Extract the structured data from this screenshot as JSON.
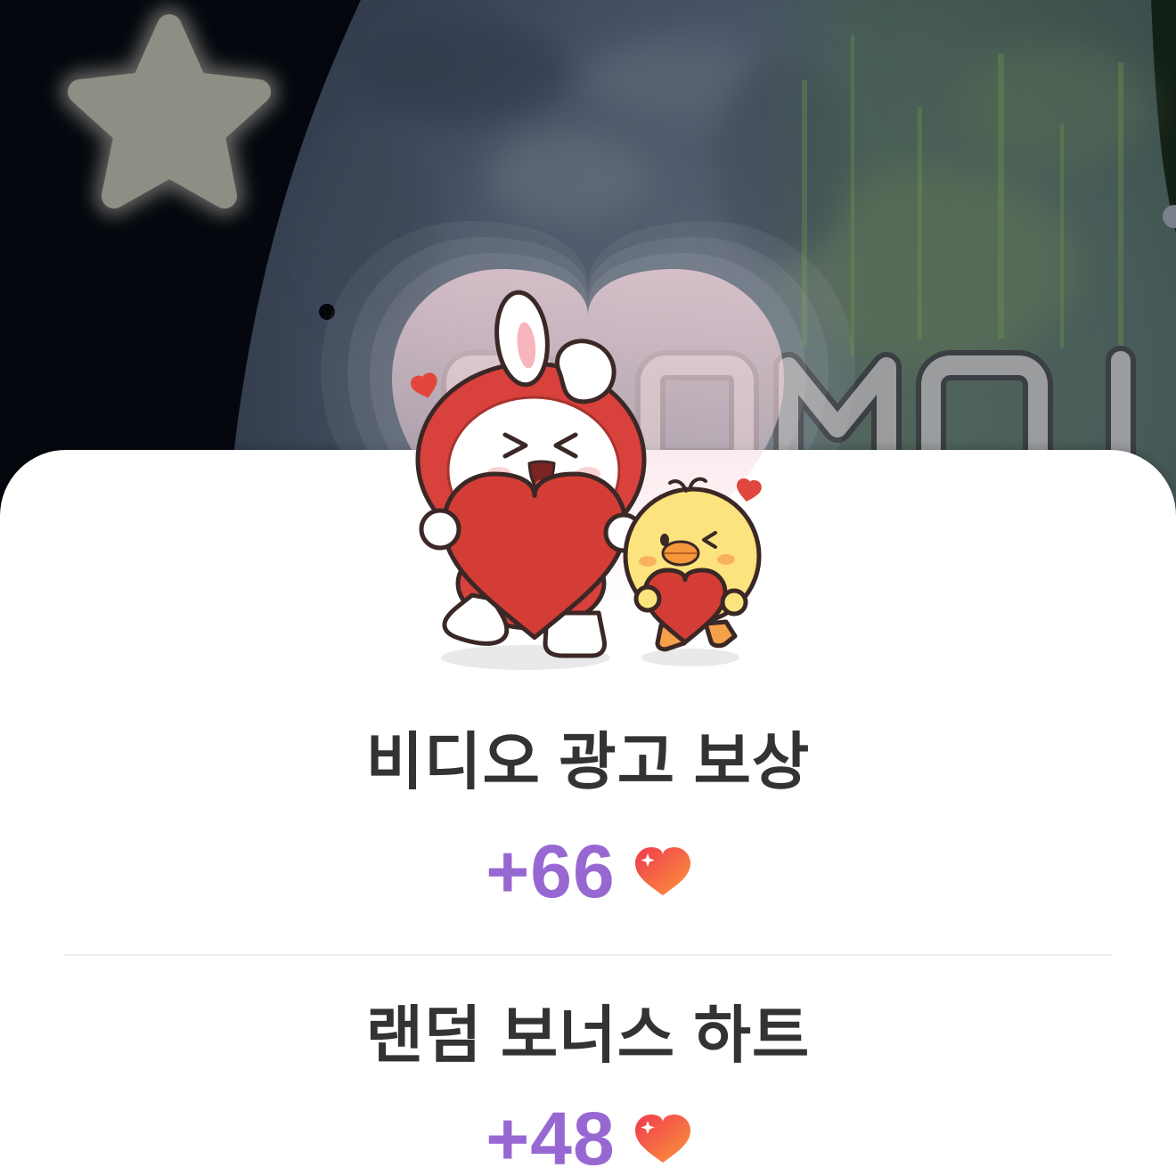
{
  "icons": {
    "background_star": "star-icon",
    "illustration": "bunny-and-chick-holding-hearts-icon",
    "reward_currency": "heart-icon"
  },
  "rewards": [
    {
      "title": "비디오 광고 보상",
      "amount": "+66"
    },
    {
      "title": "랜덤 보너스 하트",
      "amount": "+48"
    }
  ],
  "colors": {
    "title_text": "#333333",
    "amount_text": "#9868d2",
    "heart_gradient_start": "#f0394f",
    "heart_gradient_end": "#fb973a",
    "sheet_background": "#ffffff",
    "divider": "#ececec"
  }
}
